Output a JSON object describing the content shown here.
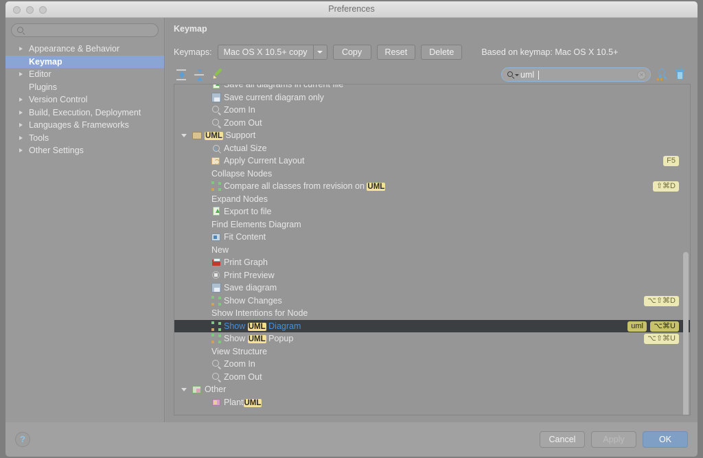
{
  "window": {
    "title": "Preferences",
    "traffic_lights": [
      "close-button",
      "minimize-button",
      "maximize-button"
    ]
  },
  "sidebar": {
    "search_placeholder": "",
    "search_value": "",
    "items": [
      {
        "label": "Appearance & Behavior",
        "expandable": true,
        "selected": false
      },
      {
        "label": "Keymap",
        "expandable": false,
        "selected": true
      },
      {
        "label": "Editor",
        "expandable": true,
        "selected": false
      },
      {
        "label": "Plugins",
        "expandable": false,
        "selected": false
      },
      {
        "label": "Version Control",
        "expandable": true,
        "selected": false
      },
      {
        "label": "Build, Execution, Deployment",
        "expandable": true,
        "selected": false
      },
      {
        "label": "Languages & Frameworks",
        "expandable": true,
        "selected": false
      },
      {
        "label": "Tools",
        "expandable": true,
        "selected": false
      },
      {
        "label": "Other Settings",
        "expandable": true,
        "selected": false
      }
    ]
  },
  "content": {
    "title": "Keymap",
    "keymaps_label": "Keymaps:",
    "keymap_selected": "Mac OS X 10.5+ copy",
    "copy_button": "Copy",
    "reset_button": "Reset",
    "delete_button": "Delete",
    "based_on": "Based on keymap: Mac OS X 10.5+"
  },
  "tree_toolbar": {
    "expand_all": "expand-all-icon",
    "collapse_all": "collapse-all-icon",
    "edit_shortcut": "edit-pencil-icon",
    "find_value": "uml",
    "find_clear": "×",
    "filter_icon": "filter-by-shortcut-icon",
    "reset_filter_icon": "clear-filter-trash-icon"
  },
  "tree": {
    "rows": [
      {
        "indent": 1,
        "icon": "export-icon",
        "label": "Save all diagrams in current file",
        "shortcut": "",
        "selected": false,
        "twisty": ""
      },
      {
        "indent": 1,
        "icon": "disk-icon",
        "label": "Save current diagram only",
        "shortcut": "",
        "selected": false,
        "twisty": ""
      },
      {
        "indent": 1,
        "icon": "zoom-in-icon",
        "label": "Zoom In",
        "shortcut": "",
        "selected": false,
        "twisty": ""
      },
      {
        "indent": 1,
        "icon": "zoom-out-icon",
        "label": "Zoom Out",
        "shortcut": "",
        "selected": false,
        "twisty": ""
      },
      {
        "indent": 0,
        "icon": "folder-icon",
        "label": "UML Support",
        "match": "UML",
        "shortcut": "",
        "selected": false,
        "twisty": "open",
        "group": true
      },
      {
        "indent": 1,
        "icon": "actual-size-icon",
        "label": "Actual Size",
        "shortcut": "",
        "selected": false,
        "twisty": ""
      },
      {
        "indent": 1,
        "icon": "layout-icon",
        "label": "Apply Current Layout",
        "shortcut": "F5",
        "selected": false,
        "twisty": ""
      },
      {
        "indent": 1,
        "icon": "",
        "label": "Collapse Nodes",
        "shortcut": "",
        "selected": false,
        "twisty": ""
      },
      {
        "indent": 1,
        "icon": "graph-icon",
        "label": "Compare all classes from revision on UML",
        "match": "UML",
        "shortcut": "⇧⌘D",
        "selected": false,
        "twisty": ""
      },
      {
        "indent": 1,
        "icon": "",
        "label": "Expand Nodes",
        "shortcut": "",
        "selected": false,
        "twisty": ""
      },
      {
        "indent": 1,
        "icon": "export-icon",
        "label": "Export to file",
        "shortcut": "",
        "selected": false,
        "twisty": ""
      },
      {
        "indent": 1,
        "icon": "",
        "label": "Find Elements Diagram",
        "shortcut": "",
        "selected": false,
        "twisty": ""
      },
      {
        "indent": 1,
        "icon": "fit-icon",
        "label": "Fit Content",
        "shortcut": "",
        "selected": false,
        "twisty": ""
      },
      {
        "indent": 1,
        "icon": "",
        "label": "New",
        "shortcut": "",
        "selected": false,
        "twisty": ""
      },
      {
        "indent": 1,
        "icon": "print-icon",
        "label": "Print Graph",
        "shortcut": "",
        "selected": false,
        "twisty": ""
      },
      {
        "indent": 1,
        "icon": "preview-icon",
        "label": "Print Preview",
        "shortcut": "",
        "selected": false,
        "twisty": ""
      },
      {
        "indent": 1,
        "icon": "disk-icon",
        "label": "Save diagram",
        "shortcut": "",
        "selected": false,
        "twisty": ""
      },
      {
        "indent": 1,
        "icon": "graph-icon",
        "label": "Show Changes",
        "shortcut": "⌥⇧⌘D",
        "selected": false,
        "twisty": ""
      },
      {
        "indent": 1,
        "icon": "",
        "label": "Show Intentions for Node",
        "shortcut": "",
        "selected": false,
        "twisty": ""
      },
      {
        "indent": 1,
        "icon": "graph-icon",
        "label": "Show UML Diagram",
        "match": "UML",
        "shortcut": "⌥⌘U",
        "abbrev": "uml",
        "selected": true,
        "twisty": ""
      },
      {
        "indent": 1,
        "icon": "graph-icon",
        "label": "Show UML Popup",
        "match": "UML",
        "shortcut": "⌥⇧⌘U",
        "selected": false,
        "twisty": ""
      },
      {
        "indent": 1,
        "icon": "",
        "label": "View Structure",
        "shortcut": "",
        "selected": false,
        "twisty": ""
      },
      {
        "indent": 1,
        "icon": "zoom-in-icon",
        "label": "Zoom In",
        "shortcut": "",
        "selected": false,
        "twisty": ""
      },
      {
        "indent": 1,
        "icon": "zoom-out-icon",
        "label": "Zoom Out",
        "shortcut": "",
        "selected": false,
        "twisty": ""
      },
      {
        "indent": 0,
        "icon": "other-folder-icon",
        "label": "Other",
        "shortcut": "",
        "selected": false,
        "twisty": "open",
        "group": true
      },
      {
        "indent": 1,
        "icon": "plant-icon",
        "label": "PlantUML",
        "match": "UML",
        "shortcut": "",
        "selected": false,
        "twisty": ""
      }
    ]
  },
  "footer": {
    "help_label": "?",
    "cancel_label": "Cancel",
    "apply_label": "Apply",
    "ok_label": "OK"
  },
  "colors": {
    "window_bg": "#9a9a9a",
    "sidebar_selection": "#8aa4d4",
    "tree_selection": "#3c3f41",
    "tree_selection_text": "#4a90d9",
    "highlight_match": "#f3e19a",
    "shortcut_chip": "#ece9b6",
    "abbrev_chip": "#9fd08a",
    "primary_button": "#7f9fc4"
  }
}
